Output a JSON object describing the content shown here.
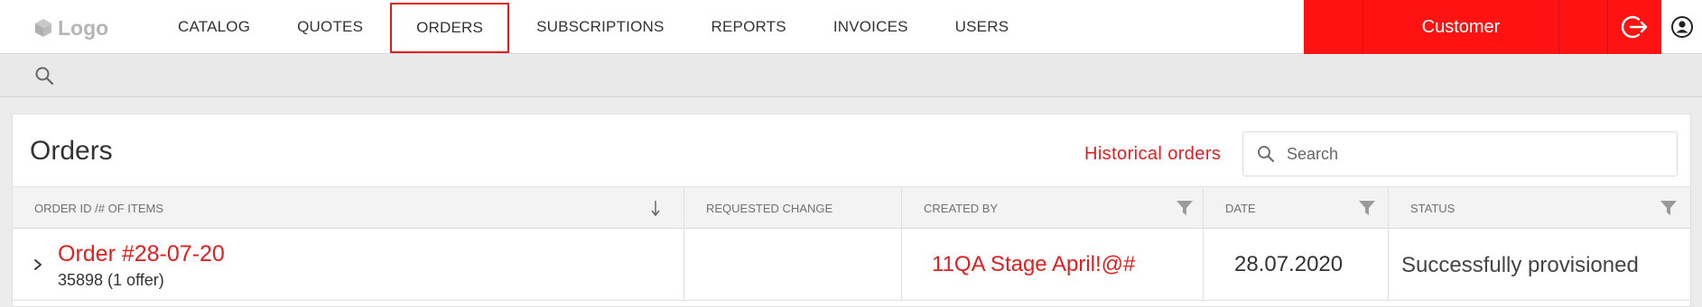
{
  "header": {
    "logo_text": "Logo",
    "nav": [
      {
        "label": "CATALOG"
      },
      {
        "label": "QUOTES"
      },
      {
        "label": "ORDERS",
        "active": true
      },
      {
        "label": "SUBSCRIPTIONS"
      },
      {
        "label": "REPORTS"
      },
      {
        "label": "INVOICES"
      },
      {
        "label": "USERS"
      }
    ],
    "customer_label": "Customer",
    "accent_color": "#ff1212"
  },
  "page": {
    "title": "Orders",
    "historical_link": "Historical orders",
    "search_placeholder": "Search"
  },
  "table": {
    "columns": [
      {
        "label": "ORDER ID /# OF ITEMS"
      },
      {
        "label": "REQUESTED CHANGE"
      },
      {
        "label": "CREATED BY"
      },
      {
        "label": "DATE"
      },
      {
        "label": "STATUS"
      }
    ],
    "rows": [
      {
        "order": "Order #28-07-20",
        "items": "35898 (1 offer)",
        "requested_change": "",
        "created_by": "11QA Stage April!@#",
        "date": "28.07.2020",
        "status": "Successfully provisioned"
      }
    ]
  },
  "icons": {
    "logo": "cube-icon",
    "search": "search-icon",
    "logout": "logout-icon",
    "user": "user-circle-icon",
    "filter": "filter-icon",
    "sort": "sort-down-arrow-icon",
    "expand": "chevron-right-icon"
  }
}
